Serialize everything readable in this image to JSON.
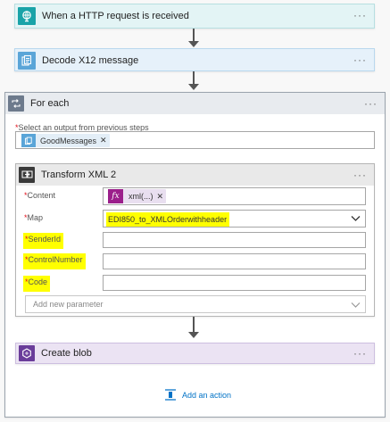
{
  "steps": {
    "http_trigger": {
      "title": "When a HTTP request is received",
      "color": "#1aa3a8"
    },
    "decode": {
      "title": "Decode X12 message",
      "color": "#5aa5d8"
    },
    "foreach": {
      "title": "For each",
      "color": "#6d7a8c",
      "select_label": "Select an output from previous steps",
      "token": "GoodMessages"
    },
    "transform": {
      "title": "Transform XML 2",
      "color": "#333333",
      "fields": {
        "content_label": "Content",
        "content_token": "xml(...)",
        "map_label": "Map",
        "map_value": "EDI850_to_XMLOrderwithheader",
        "senderid_label": "SenderId",
        "controlnumber_label": "ControlNumber",
        "code_label": "Code",
        "add_param_placeholder": "Add new parameter"
      }
    },
    "blob": {
      "title": "Create blob",
      "color": "#6a3d9a"
    },
    "add_action": "Add an action"
  },
  "icons": {
    "http": "globe-icon",
    "decode": "document-stack-icon",
    "foreach": "loop-icon",
    "transform": "transform-xml-icon",
    "blob": "blob-hexagon-icon",
    "fx": "fx-function-icon",
    "add_action": "add-action-icon"
  },
  "colors": {
    "highlight": "#ffff00",
    "required_star": "#e0101a",
    "fx_tile": "#9b1f8b",
    "link": "#0072c6"
  }
}
